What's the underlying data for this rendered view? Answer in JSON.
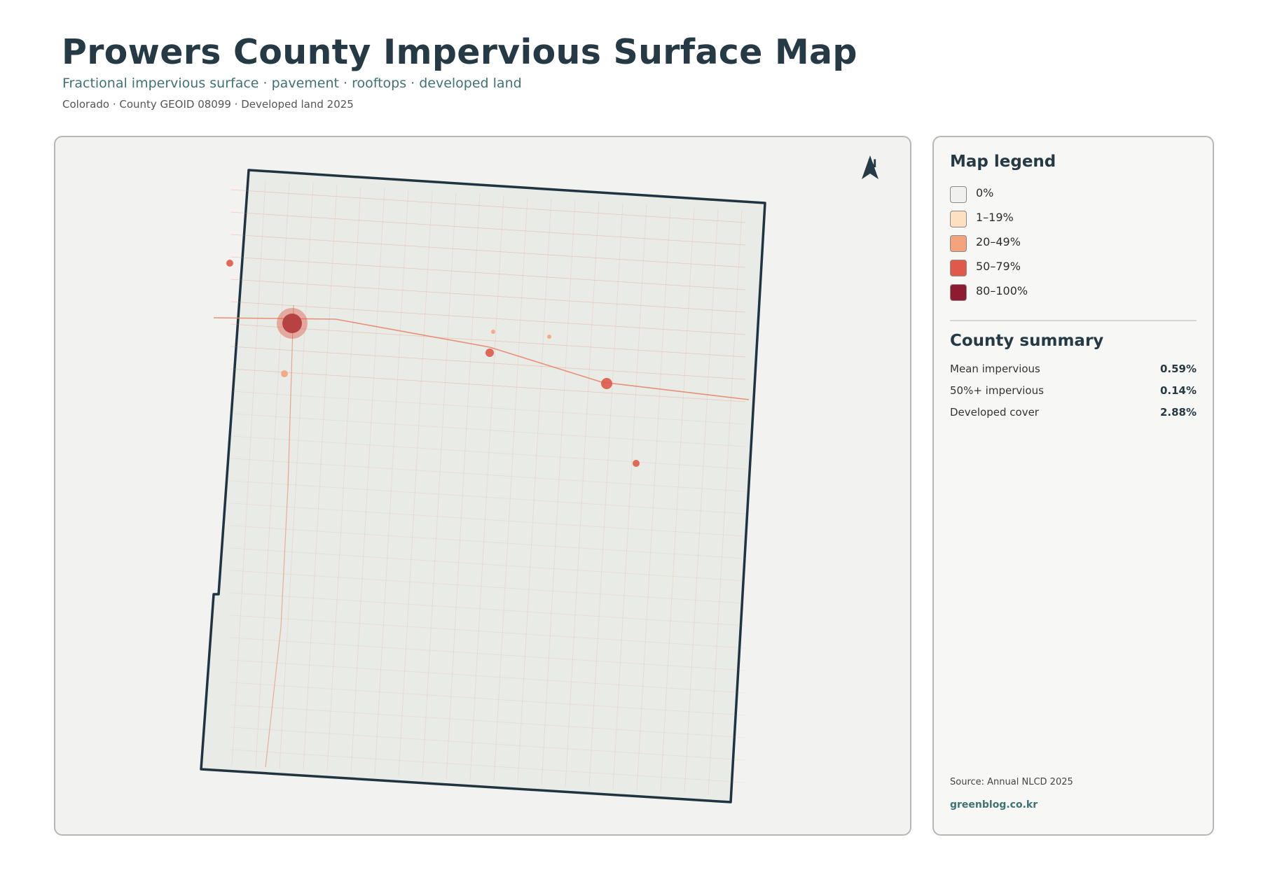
{
  "header": {
    "title": "Prowers County Impervious Surface Map",
    "subtitle": "Fractional impervious surface · pavement · rooftops · developed land",
    "meta": "Colorado · County GEOID 08099 · Developed land 2025"
  },
  "map": {
    "north_label": "N",
    "county_fill": "#e8ebe6",
    "county_outline": "#1f3440",
    "road_color": "#e8866a",
    "town_color": "#c0392b"
  },
  "legend": {
    "title": "Map legend",
    "items": [
      {
        "label": "0%",
        "color": "#f0f0ee"
      },
      {
        "label": "1–19%",
        "color": "#fde0bf"
      },
      {
        "label": "20–49%",
        "color": "#f4a47d"
      },
      {
        "label": "50–79%",
        "color": "#de5a4a"
      },
      {
        "label": "80–100%",
        "color": "#8e1b2f"
      }
    ]
  },
  "summary": {
    "title": "County summary",
    "stats": [
      {
        "label": "Mean impervious",
        "value": "0.59%"
      },
      {
        "label": "50%+ impervious",
        "value": "0.14%"
      },
      {
        "label": "Developed cover",
        "value": "2.88%"
      }
    ]
  },
  "footer": {
    "source": "Source: Annual NLCD 2025",
    "credit": "greenblog.co.kr"
  }
}
